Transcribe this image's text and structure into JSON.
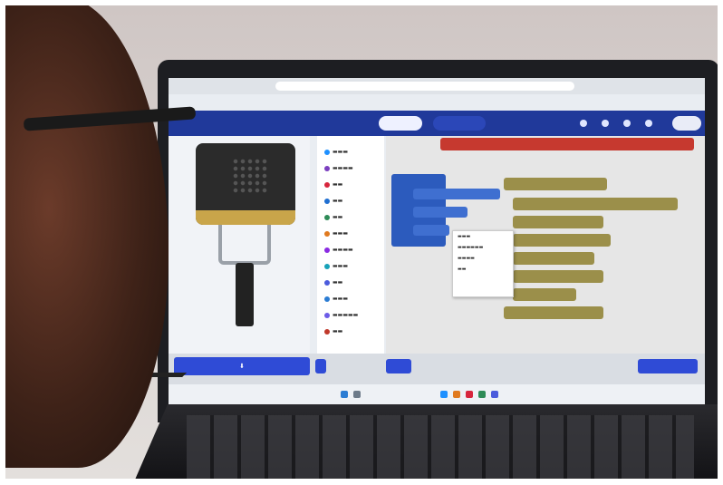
{
  "scene": {
    "subject": "person-viewing-laptop",
    "app": {
      "header": {
        "left_label": "",
        "tab_active": "",
        "tab_other": ""
      },
      "toolbox": {
        "category_colors": [
          "#1e90ff",
          "#7b3fbf",
          "#d7263d",
          "#1f6fd1",
          "#2e8b57",
          "#e07a1f",
          "#8a2be2",
          "#17a2b8",
          "#4b5bdc",
          "#2b7cd3",
          "#6c5ce7",
          "#c0392b"
        ]
      },
      "context_menu": {
        "items_visible": 4
      },
      "colors": {
        "header": "#20399a",
        "download_button": "#2f4bd6",
        "block_red": "#c6392f",
        "block_blue": "#2c5bbd",
        "block_olive": "#9b8f4a"
      }
    }
  }
}
